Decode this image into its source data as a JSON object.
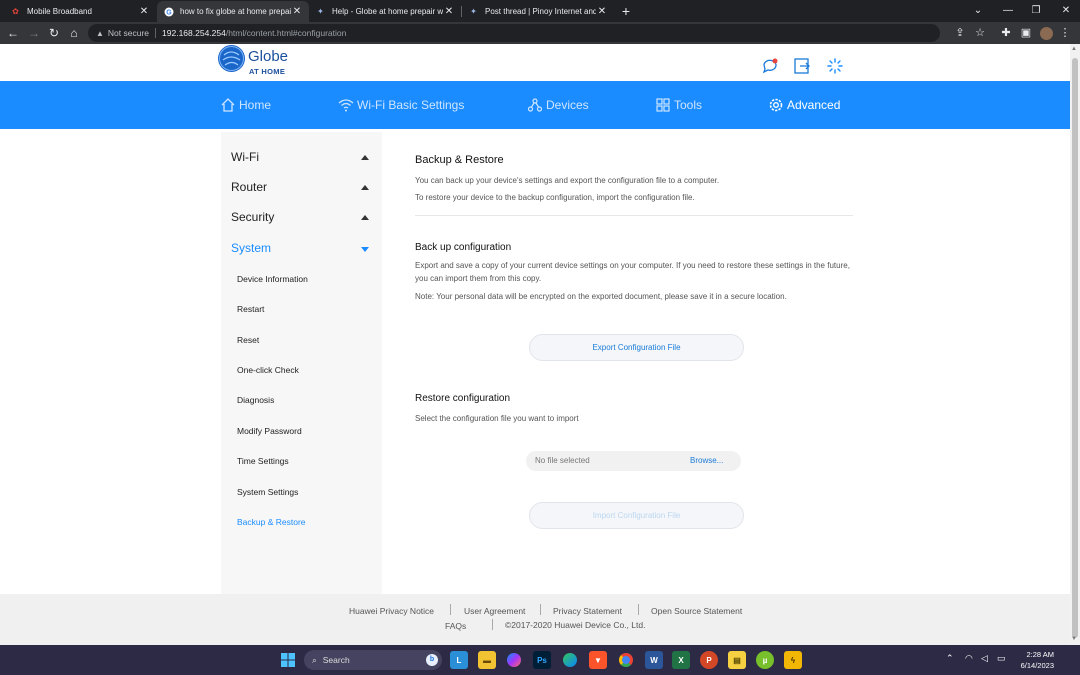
{
  "browser": {
    "tabs": [
      {
        "title": "Mobile Broadband",
        "close": "✕"
      },
      {
        "title": "how to fix globe at home prepaid",
        "close": "✕"
      },
      {
        "title": "Help - Globe at home prepair wifi",
        "close": "✕"
      },
      {
        "title": "Post thread | Pinoy Internet and",
        "close": "✕"
      }
    ],
    "new_tab": "+",
    "not_secure": "Not secure",
    "url_host": "192.168.254.254",
    "url_path": "/html/content.html#configuration"
  },
  "header": {
    "brand": "Globe",
    "brand_sub": "AT HOME"
  },
  "nav": {
    "home": "Home",
    "wifi": "Wi-Fi Basic Settings",
    "devices": "Devices",
    "tools": "Tools",
    "advanced": "Advanced"
  },
  "sidebar": {
    "groups": {
      "wifi": "Wi-Fi",
      "router": "Router",
      "security": "Security",
      "system": "System"
    },
    "items": [
      "Device Information",
      "Restart",
      "Reset",
      "One-click Check",
      "Diagnosis",
      "Modify Password",
      "Time Settings",
      "System Settings",
      "Backup & Restore"
    ]
  },
  "content": {
    "title": "Backup & Restore",
    "intro1": "You can back up your device's settings and export the configuration file to a computer.",
    "intro2": "To restore your device to the backup configuration, import the configuration file.",
    "backup_title": "Back up configuration",
    "backup_desc": "Export and save a copy of your current device settings on your computer. If you need to restore these settings in the future, you can import them from this copy.",
    "backup_note": "Note: Your personal data will be encrypted on the exported document, please save it in a secure location.",
    "export_btn": "Export Configuration File",
    "restore_title": "Restore configuration",
    "restore_desc": "Select the configuration file you want to import",
    "no_file": "No file selected",
    "browse": "Browse...",
    "import_btn": "Import Configuration File"
  },
  "footer": {
    "privacy_notice": "Huawei Privacy Notice",
    "user_agreement": "User Agreement",
    "privacy_statement": "Privacy Statement",
    "open_source": "Open Source Statement",
    "faqs": "FAQs",
    "copyright": "©2017-2020 Huawei Device Co., Ltd."
  },
  "taskbar": {
    "search": "Search",
    "time": "2:28 AM",
    "date": "6/14/2023"
  },
  "colors": {
    "accent": "#1a8cff",
    "nav_bg": "#1a8cff",
    "link": "#1a7bd9"
  }
}
